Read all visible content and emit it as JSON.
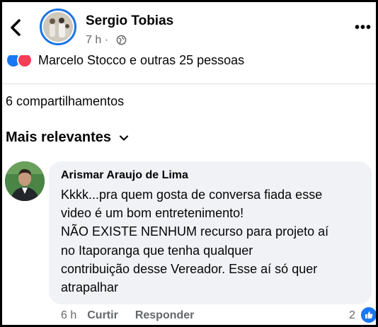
{
  "header": {
    "author": "Sergio Tobias",
    "time": "7 h ·",
    "more": "•••"
  },
  "reactions": {
    "text": "Marcelo Stocco e outras 25 pessoas"
  },
  "shares": "6 compartilhamentos",
  "filter": {
    "label": "Mais relevantes"
  },
  "comment": {
    "author": "Arismar Araujo de Lima",
    "lines": [
      "Kkkk...pra quem gosta de conversa fiada esse",
      "video é um bom entretenimento!",
      "NÃO EXISTE NENHUM recurso para projeto aí",
      "no Itaporanga que tenha qualquer",
      "contribuição desse Vereador. Esse aí só quer",
      "atrapalhar"
    ],
    "time": "6 h",
    "like_label": "Curtir",
    "reply_label": "Responder",
    "like_count": "2"
  },
  "colors": {
    "accent": "#1877f2",
    "love": "#f33e58",
    "bubble_bg": "#f0f2f5",
    "secondary_text": "#65676b"
  }
}
